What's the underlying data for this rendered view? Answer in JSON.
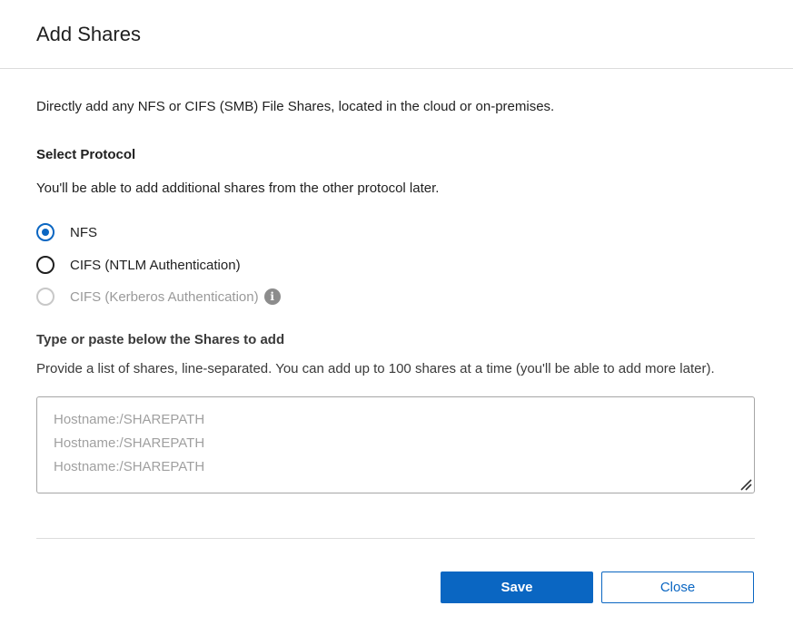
{
  "dialog": {
    "title": "Add Shares"
  },
  "intro": "Directly add any NFS or CIFS (SMB) File Shares, located in the cloud or on-premises.",
  "protocol": {
    "heading": "Select Protocol",
    "helper": "You'll be able to add additional shares from the other protocol later.",
    "options": [
      {
        "label": "NFS",
        "checked": true,
        "disabled": false
      },
      {
        "label": "CIFS (NTLM Authentication)",
        "checked": false,
        "disabled": false
      },
      {
        "label": "CIFS (Kerberos Authentication)",
        "checked": false,
        "disabled": true,
        "icon": "info-icon"
      }
    ]
  },
  "shares": {
    "heading": "Type or paste below the Shares to add",
    "helper": "Provide a list of shares, line-separated. You can add up to 100 shares at a time (you'll be able to add more later).",
    "placeholder_lines": [
      "Hostname:/SHAREPATH",
      "Hostname:/SHAREPATH",
      "Hostname:/SHAREPATH"
    ]
  },
  "footer": {
    "save_label": "Save",
    "close_label": "Close"
  },
  "colors": {
    "accent": "#0a66c2",
    "disabled": "#c8c8c8"
  }
}
